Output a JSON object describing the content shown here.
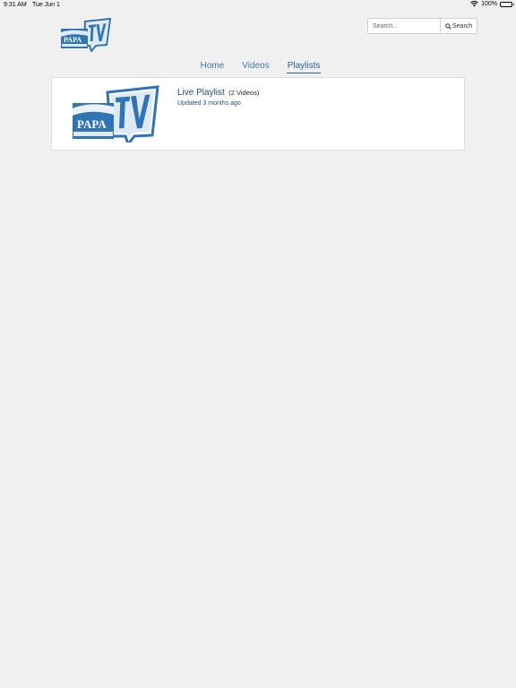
{
  "status_bar": {
    "time": "9:31 AM",
    "date": "Tue Jun 1",
    "battery": "100%"
  },
  "header": {
    "logo_text": "PAPA TV",
    "logo_word": "PAPA"
  },
  "search": {
    "placeholder": "Search...",
    "button_label": "Search"
  },
  "nav": {
    "tabs": [
      {
        "label": "Home",
        "active": false
      },
      {
        "label": "Videos",
        "active": false
      },
      {
        "label": "Playlists",
        "active": true
      }
    ]
  },
  "playlist": {
    "title": "Live Playlist",
    "count": "(2 Videos)",
    "updated": "Updated 3 months ago"
  },
  "colors": {
    "background": "#f0f0f0",
    "link": "#3d7ab8",
    "title": "#1f4e79",
    "logo_blue": "#2f74b5"
  }
}
